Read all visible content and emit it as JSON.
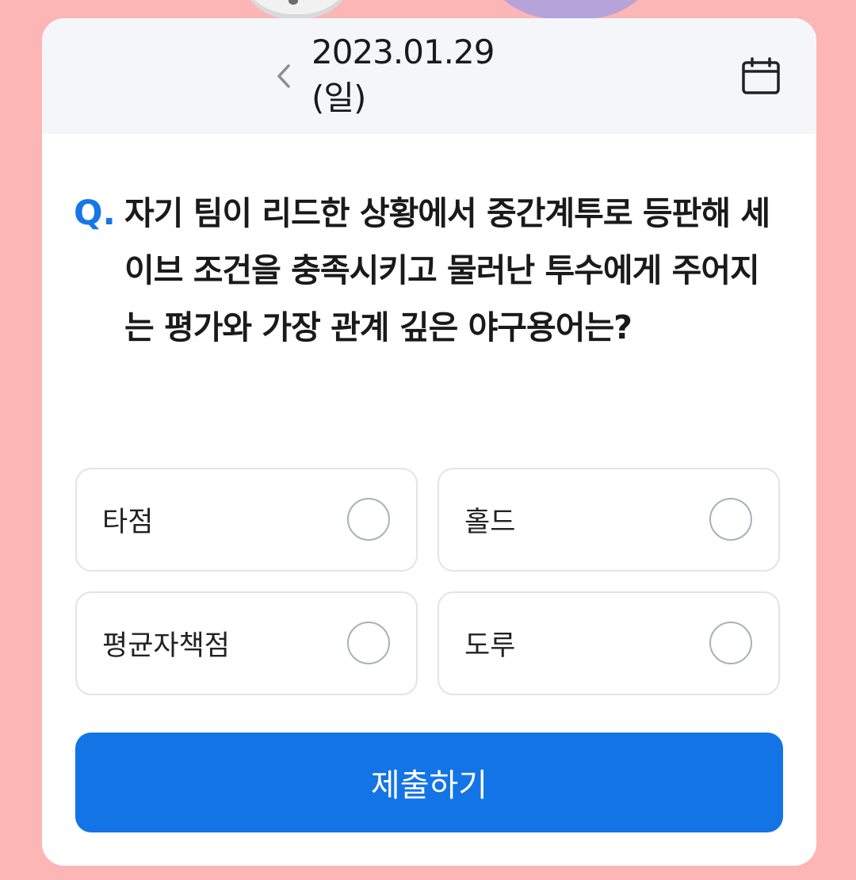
{
  "header": {
    "date": "2023.01.29 (일)",
    "prev_icon": "chevron-left-icon",
    "calendar_icon": "calendar-icon"
  },
  "question": {
    "prefix": "Q.",
    "text": "자기 팀이 리드한 상황에서 중간계투로 등판해 세이브 조건을 충족시키고 물러난 투수에게 주어지는 평가와 가장 관계 깊은 야구용어는?"
  },
  "options": [
    {
      "label": "타점"
    },
    {
      "label": "홀드"
    },
    {
      "label": "평균자책점"
    },
    {
      "label": "도루"
    }
  ],
  "submit": {
    "label": "제출하기"
  },
  "colors": {
    "background": "#fdb6b6",
    "accent": "#1374e6",
    "header_bg": "#f5f6fa"
  }
}
